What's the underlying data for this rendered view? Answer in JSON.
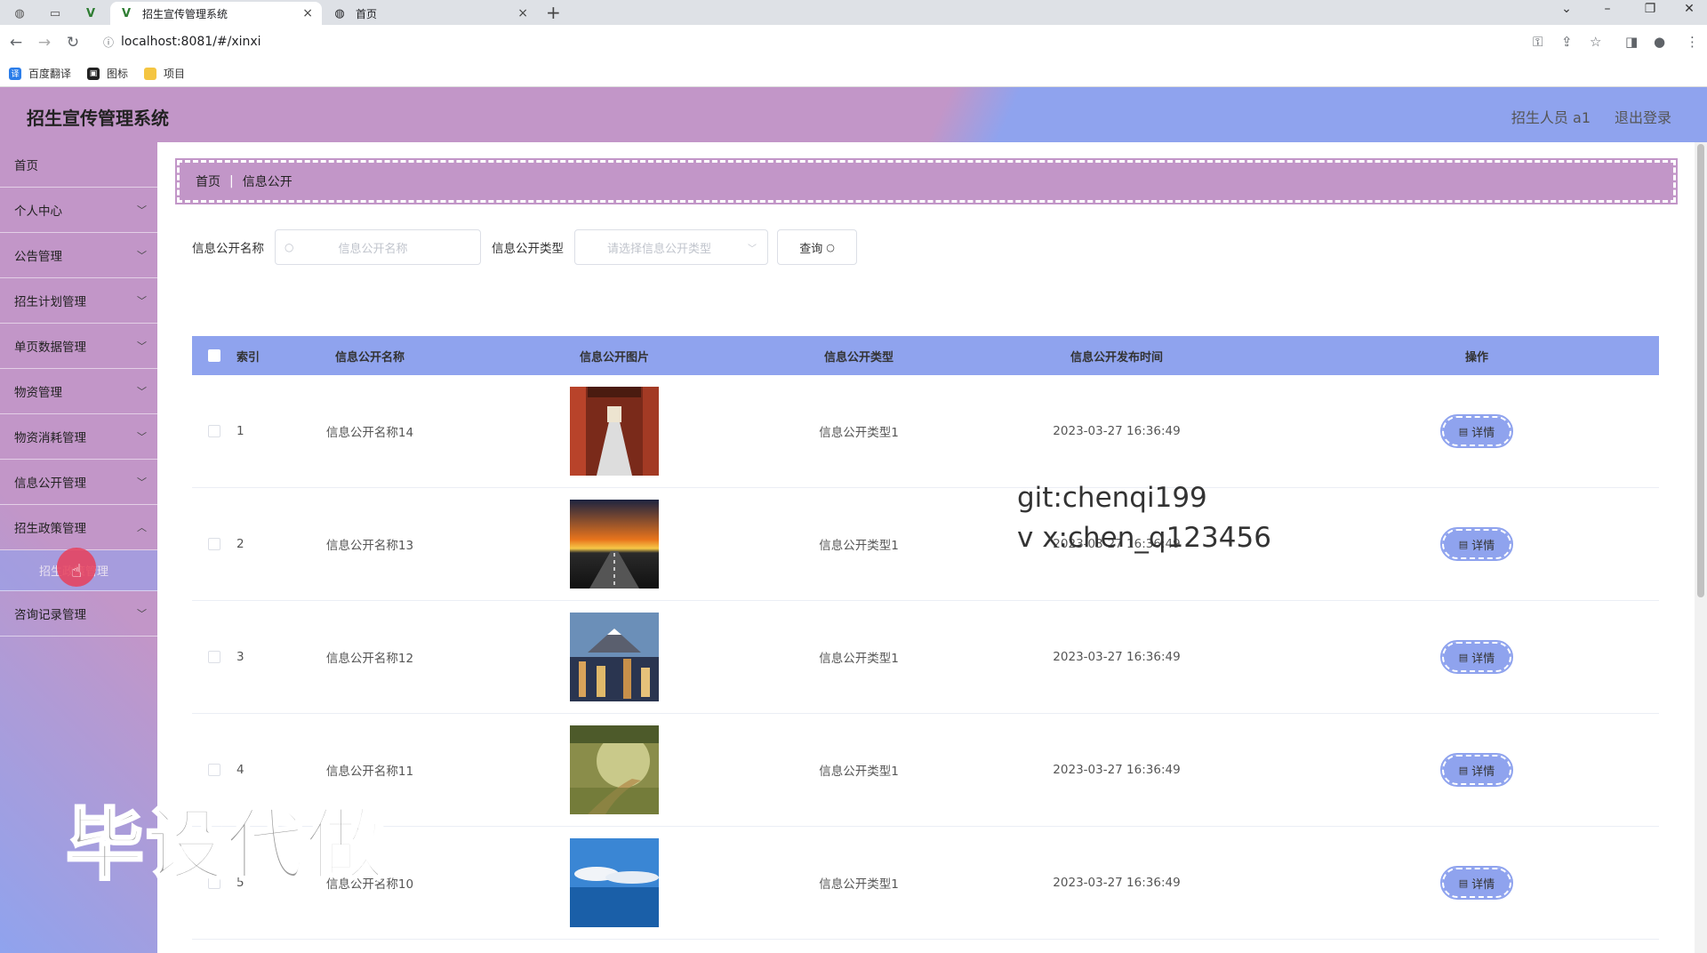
{
  "browser": {
    "tabs": [
      {
        "title": "招生宣传管理系统",
        "close": "×"
      },
      {
        "title": "首页",
        "close": "×"
      }
    ],
    "new_tab": "+",
    "url": "localhost:8081/#/xinxi",
    "bookmarks": [
      "百度翻译",
      "图标",
      "项目"
    ]
  },
  "header": {
    "title": "招生宣传管理系统",
    "user": "招生人员 a1",
    "logout": "退出登录"
  },
  "sidebar": {
    "items": [
      {
        "label": "首页"
      },
      {
        "label": "个人中心"
      },
      {
        "label": "公告管理"
      },
      {
        "label": "招生计划管理"
      },
      {
        "label": "单页数据管理"
      },
      {
        "label": "物资管理"
      },
      {
        "label": "物资消耗管理"
      },
      {
        "label": "信息公开管理"
      },
      {
        "label": "招生政策管理"
      },
      {
        "label": "咨询记录管理"
      }
    ],
    "submenu_label": "招生政策管理"
  },
  "breadcrumb": {
    "home": "首页",
    "current": "信息公开"
  },
  "search": {
    "name_label": "信息公开名称",
    "name_placeholder": "信息公开名称",
    "type_label": "信息公开类型",
    "type_placeholder": "请选择信息公开类型",
    "query_button": "查询"
  },
  "table": {
    "headers": {
      "index": "索引",
      "name": "信息公开名称",
      "image": "信息公开图片",
      "type": "信息公开类型",
      "time": "信息公开发布时间",
      "op": "操作"
    },
    "detail_label": "详情",
    "rows": [
      {
        "index": "1",
        "name": "信息公开名称14",
        "type": "信息公开类型1",
        "time": "2023-03-27 16:36:49"
      },
      {
        "index": "2",
        "name": "信息公开名称13",
        "type": "信息公开类型1",
        "time": "2023-03-27 16:36:49"
      },
      {
        "index": "3",
        "name": "信息公开名称12",
        "type": "信息公开类型1",
        "time": "2023-03-27 16:36:49"
      },
      {
        "index": "4",
        "name": "信息公开名称11",
        "type": "信息公开类型1",
        "time": "2023-03-27 16:36:49"
      },
      {
        "index": "5",
        "name": "信息公开名称10",
        "type": "信息公开类型1",
        "time": "2023-03-27 16:36:49"
      }
    ]
  },
  "watermarks": {
    "line1": "git:chenqi199",
    "line2": "v x:chen_q123456",
    "overlay": "毕设代做"
  }
}
